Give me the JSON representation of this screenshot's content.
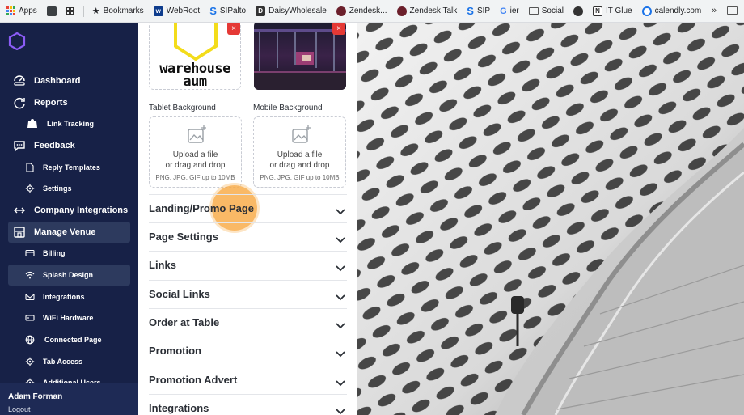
{
  "bookmarks": {
    "items": [
      {
        "label": "Apps",
        "icon": "apps-grid-icon"
      },
      {
        "label": "",
        "icon": "square-icon"
      },
      {
        "label": "",
        "icon": "grid-icon"
      },
      {
        "label": "Bookmarks",
        "icon": "star-icon"
      },
      {
        "label": "WebRoot",
        "icon": "webroot-icon"
      },
      {
        "label": "SIPalto",
        "icon": "sipalto-icon"
      },
      {
        "label": "DaisyWholesale",
        "icon": "daisy-icon"
      },
      {
        "label": "Zendesk...",
        "icon": "zendesk-icon"
      },
      {
        "label": "Zendesk Talk",
        "icon": "zendesk-icon"
      },
      {
        "label": "SIP",
        "icon": "sip-icon"
      },
      {
        "label": "ier",
        "icon": "google-icon"
      },
      {
        "label": "Social",
        "icon": "folder-icon"
      },
      {
        "label": "",
        "icon": "globe-icon"
      },
      {
        "label": "IT Glue",
        "icon": "itglue-icon"
      },
      {
        "label": "calendly.com",
        "icon": "calendly-icon"
      }
    ],
    "more": "»"
  },
  "sidebar": {
    "items": [
      {
        "label": "Dashboard",
        "icon": "dashboard-icon",
        "level": "main"
      },
      {
        "label": "Reports",
        "icon": "reports-icon",
        "level": "main"
      },
      {
        "label": "Link Tracking",
        "icon": "link-tracking-icon",
        "level": "sub"
      },
      {
        "label": "Feedback",
        "icon": "feedback-icon",
        "level": "main"
      },
      {
        "label": "Reply Templates",
        "icon": "document-icon",
        "level": "sub"
      },
      {
        "label": "Settings",
        "icon": "gear-icon",
        "level": "sub"
      },
      {
        "label": "Company Integrations",
        "icon": "plug-icon",
        "level": "main"
      },
      {
        "label": "Manage Venue",
        "icon": "building-icon",
        "level": "main",
        "active": true
      },
      {
        "label": "Billing",
        "icon": "billing-icon",
        "level": "sub"
      },
      {
        "label": "Splash Design",
        "icon": "wifi-icon",
        "level": "sub",
        "active": true
      },
      {
        "label": "Integrations",
        "icon": "mail-icon",
        "level": "sub"
      },
      {
        "label": "WiFi Hardware",
        "icon": "hardware-icon",
        "level": "sub"
      },
      {
        "label": "Connected Page",
        "icon": "globe-icon",
        "level": "sub"
      },
      {
        "label": "Tab Access",
        "icon": "gear-icon",
        "level": "sub"
      },
      {
        "label": "Additional Users",
        "icon": "gear-icon",
        "level": "sub"
      }
    ],
    "user": {
      "name": "Adam Forman",
      "logout": "Logout"
    }
  },
  "panel": {
    "logo_text": "warehouse aum",
    "remove_label": "×",
    "tablet_label": "Tablet Background",
    "mobile_label": "Mobile Background",
    "upload": {
      "line1": "Upload a file",
      "line2": "or drag and drop",
      "line3": "PNG, JPG, GIF up to 10MB"
    },
    "sections": [
      "Landing/Promo Page",
      "Page Settings",
      "Links",
      "Social Links",
      "Order at Table",
      "Promotion",
      "Promotion Advert",
      "Integrations"
    ]
  },
  "colors": {
    "sidebar_bg": "#172147",
    "sidebar_active": "#2d3a5e",
    "accent_remove": "#e53935",
    "highlight": "#f7a840",
    "logo_yellow": "#f3dc1b"
  }
}
